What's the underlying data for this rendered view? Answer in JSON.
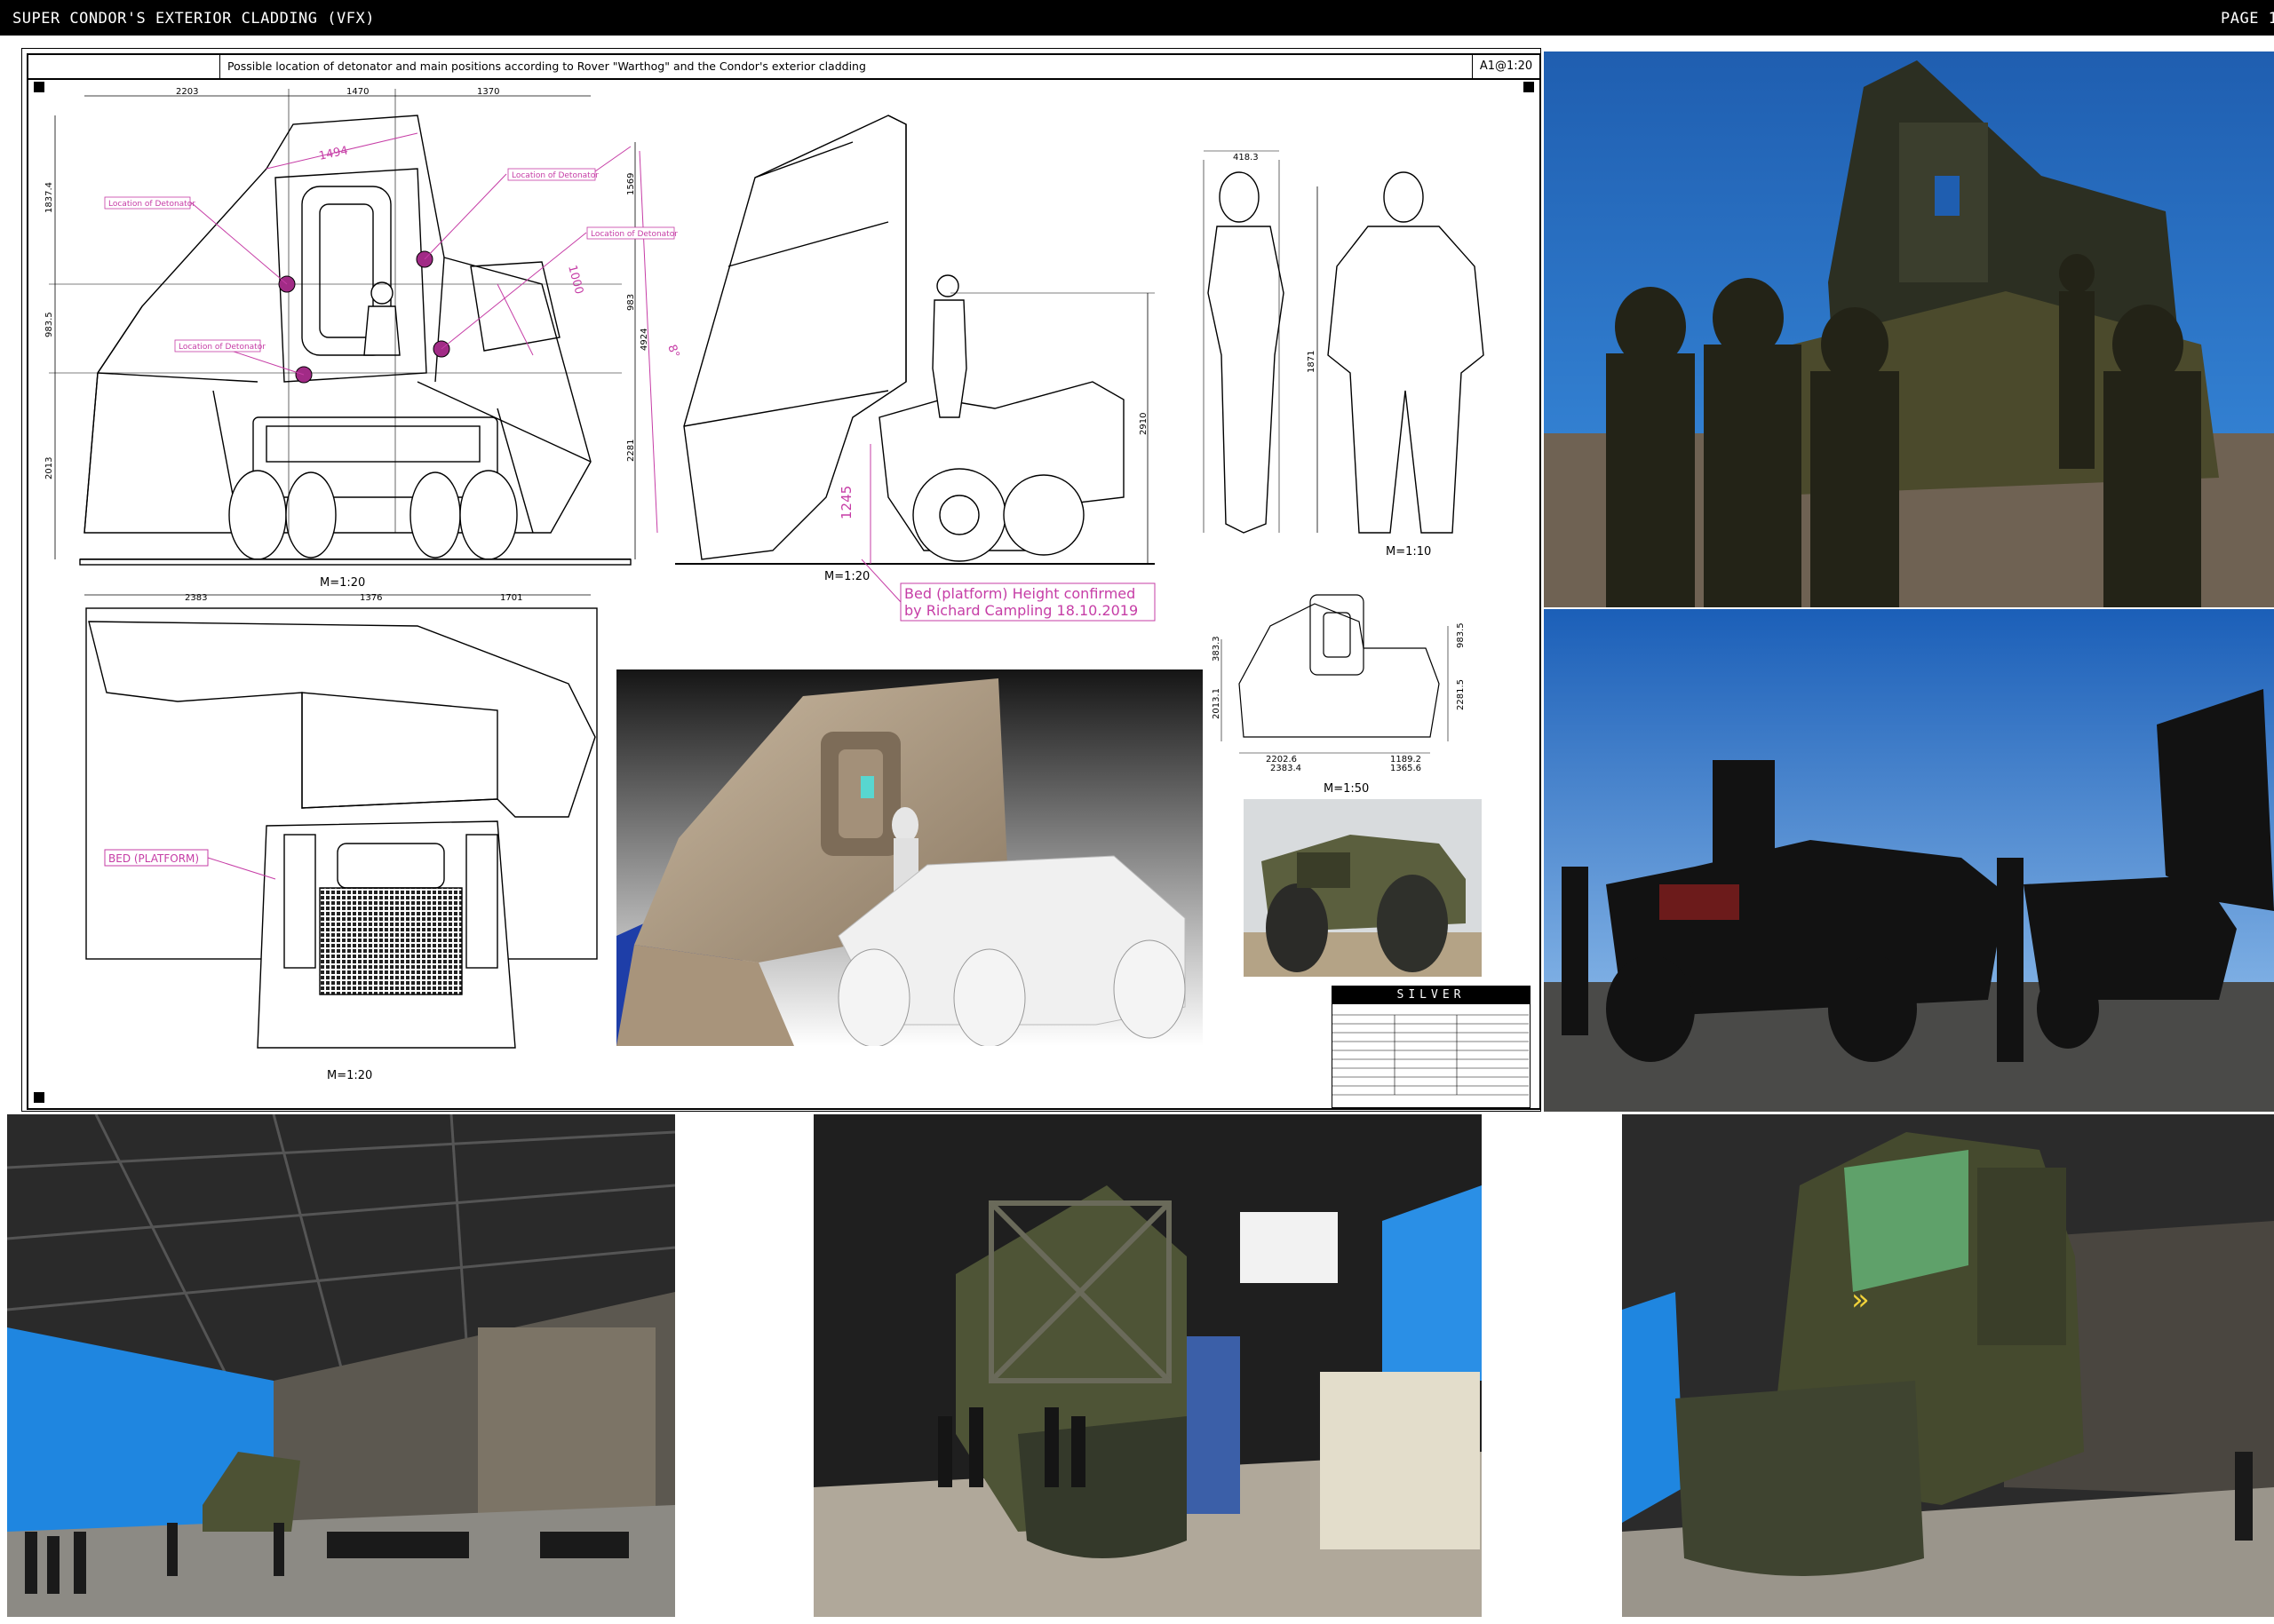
{
  "header": {
    "title": "SUPER CONDOR'S EXTERIOR CLADDING (VFX)",
    "page": "PAGE 1"
  },
  "sheet": {
    "caption": "Possible location of detonator and main positions according to Rover \"Warthog\" and the Condor's exterior cladding",
    "scale_box": "A1@1:20"
  },
  "labels": {
    "detonator": "Location of Detonator",
    "bed_platform": "BED (PLATFORM)",
    "confirm_line1": "Bed (platform) Height confirmed",
    "confirm_line2": "by Richard Campling 18.10.2019",
    "scale_front": "M=1:20",
    "scale_side": "M=1:20",
    "scale_figures": "M=1:10",
    "scale_plan": "M=1:20",
    "scale_small": "M=1:50"
  },
  "dimensions": {
    "front_top": [
      "2203",
      "1470",
      "1370"
    ],
    "front_bottom": [
      "2383",
      "1376",
      "1701"
    ],
    "front_left": [
      "1837.4",
      "983.5",
      "2013"
    ],
    "front_right": [
      "1569",
      "983",
      "4924",
      "2281"
    ],
    "front_angles": [
      "1494",
      "1000",
      "8°"
    ],
    "side": [
      "2910",
      "1245"
    ],
    "figures": [
      "418.3",
      "1871"
    ],
    "small_top": [
      "383.3",
      "2013.1",
      "983.5",
      "2281.5"
    ],
    "small_bottom": [
      "2202.6",
      "2383.4",
      "1189.2",
      "1365.6"
    ]
  },
  "title_block": {
    "brand": "SILVER"
  },
  "colors": {
    "topbar": "#000000",
    "annotation": "#c63da6",
    "cladding_tan": "#b7a48c",
    "bluescreen": "#1e6fcf",
    "hangar_floor": "#8c8a84"
  }
}
